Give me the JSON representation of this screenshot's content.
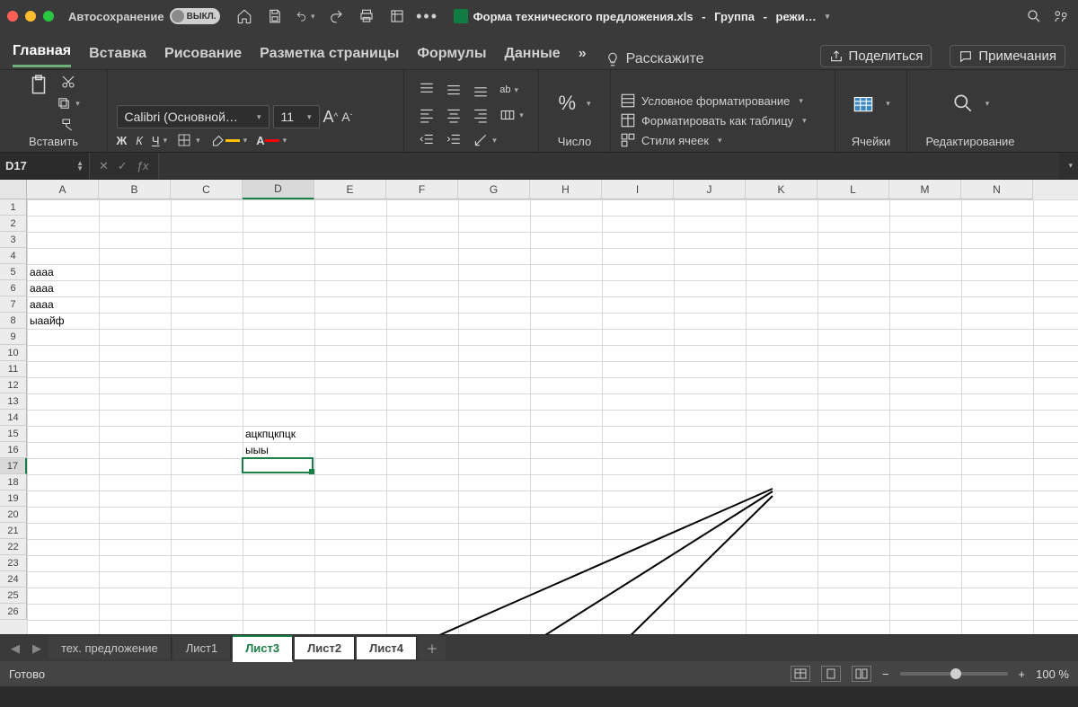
{
  "titlebar": {
    "autosave_label": "Автосохранение",
    "autosave_state": "ВЫКЛ.",
    "filename": "Форма технического предложения.xls",
    "group": "Группа",
    "mode": "режи…"
  },
  "tabs": {
    "home": "Главная",
    "insert": "Вставка",
    "draw": "Рисование",
    "layout": "Разметка страницы",
    "formulas": "Формулы",
    "data": "Данные",
    "more": "»",
    "tell_me": "Расскажите",
    "share": "Поделиться",
    "comments": "Примечания"
  },
  "ribbon": {
    "paste": "Вставить",
    "font_name": "Calibri (Основной…",
    "font_size": "11",
    "bold": "Ж",
    "italic": "К",
    "underline": "Ч",
    "number": "Число",
    "cond_format": "Условное форматирование",
    "as_table": "Форматировать как таблицу",
    "cell_styles": "Стили ячеек",
    "cells": "Ячейки",
    "editing": "Редактирование"
  },
  "fxbar": {
    "cellref": "D17",
    "fx": "ƒx"
  },
  "columns": [
    "A",
    "B",
    "C",
    "D",
    "E",
    "F",
    "G",
    "H",
    "I",
    "J",
    "K",
    "L",
    "M",
    "N"
  ],
  "rows_count": 26,
  "active_col": "D",
  "active_row": 17,
  "cells": {
    "A5": "аааа",
    "A6": "аааа",
    "A7": "аааа",
    "A8": "ыаайф",
    "D15": "ацкпцкпцк",
    "D16": "ыыы"
  },
  "sheettabs": {
    "t0": "тех. предложение",
    "t1": "Лист1",
    "t2": "Лист3",
    "t3": "Лист2",
    "t4": "Лист4"
  },
  "status": {
    "ready": "Готово",
    "zoom": "100 %"
  }
}
